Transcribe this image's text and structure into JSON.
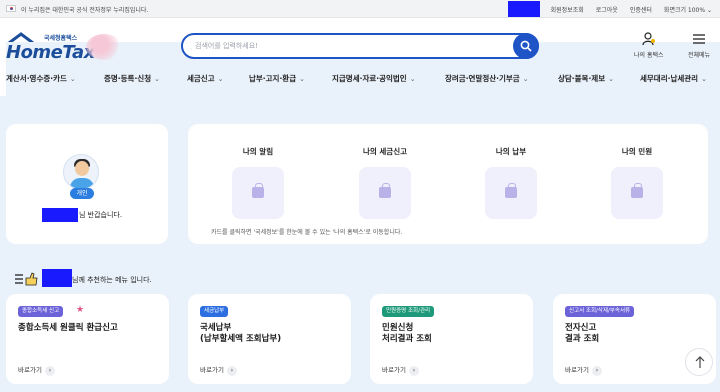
{
  "topbar": {
    "notice": "이 누리집은 대한민국 공식 전자정부 누리집입니다.",
    "links": [
      "회원정보조회",
      "로그아웃",
      "인증센터",
      "화면크기 100% ⌄"
    ]
  },
  "header": {
    "logo_sub": "국세청홈택스",
    "logo_main": "HomeTax",
    "search_placeholder": "검색어를 입력하세요!",
    "my_hometax": "나의 홈택스",
    "all_menu": "전체메뉴"
  },
  "nav": {
    "items": [
      "계산서·영수증·카드",
      "증명·등록·신청",
      "세금신고",
      "납부·고지·환급",
      "지급명세·자료·공익법인",
      "장려금·연말정산·기부금",
      "상담·불복·제보",
      "세무대리·납세관리"
    ]
  },
  "profile": {
    "badge": "개인",
    "greeting_suffix": "님 반갑습니다."
  },
  "mine": {
    "cols": [
      "나의 알림",
      "나의 세금신고",
      "나의 납부",
      "나의 민원"
    ],
    "hint": "카드를 클릭하면 '국세정보'를 한눈에 볼 수 있는 '나의 홈택스'로 이동합니다."
  },
  "recommend": {
    "title_suffix": "님께 추천하는 메뉴 입니다.",
    "go_label": "바로가기",
    "cards": [
      {
        "tag": "종합소득세 신고",
        "tag_color": "#6c63d9",
        "title": "종합소득세 원클릭 환급신고"
      },
      {
        "tag": "세금납부",
        "tag_color": "#2d6fe0",
        "title": "국세납부\n(납부할세액 조회납부)"
      },
      {
        "tag": "민원증명 조회/관리",
        "tag_color": "#1e9a7a",
        "title": "민원신청\n처리결과 조회"
      },
      {
        "tag": "신고서 조회/삭제/부속서류",
        "tag_color": "#6c63d9",
        "title": "전자신고\n결과 조회"
      }
    ]
  }
}
